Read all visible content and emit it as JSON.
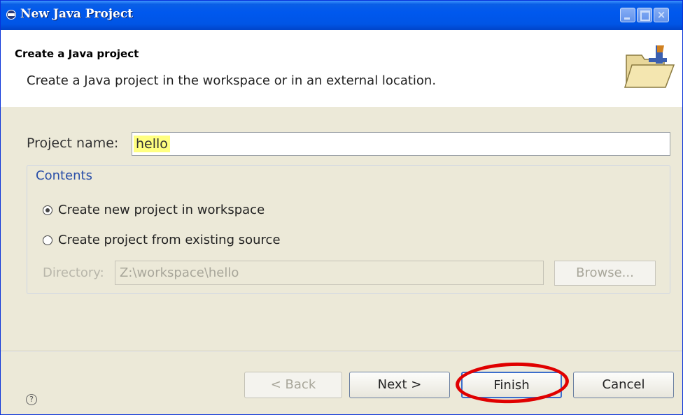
{
  "window": {
    "title": "New Java Project",
    "controls": {
      "minimize": "minimize-icon",
      "maximize": "maximize-icon",
      "close": "×"
    }
  },
  "header": {
    "title": "Create a Java project",
    "description": "Create a Java project in the workspace or in an external location.",
    "icon": "new-folder-icon"
  },
  "form": {
    "project_name_label": "Project name:",
    "project_name_value": "hello",
    "contents_group_title": "Contents",
    "options": [
      {
        "label": "Create new project in workspace",
        "selected": true
      },
      {
        "label": "Create project from existing source",
        "selected": false
      }
    ],
    "directory_label": "Directory:",
    "directory_value": "Z:\\workspace\\hello",
    "browse_label": "Browse..."
  },
  "footer": {
    "help_icon": "?",
    "back_label": "< Back",
    "next_label": "Next >",
    "finish_label": "Finish",
    "cancel_label": "Cancel"
  },
  "colors": {
    "titlebar": "#0055e5",
    "highlight": "#ffff80",
    "annotation": "#e00000",
    "group_title": "#2a4fa8"
  }
}
